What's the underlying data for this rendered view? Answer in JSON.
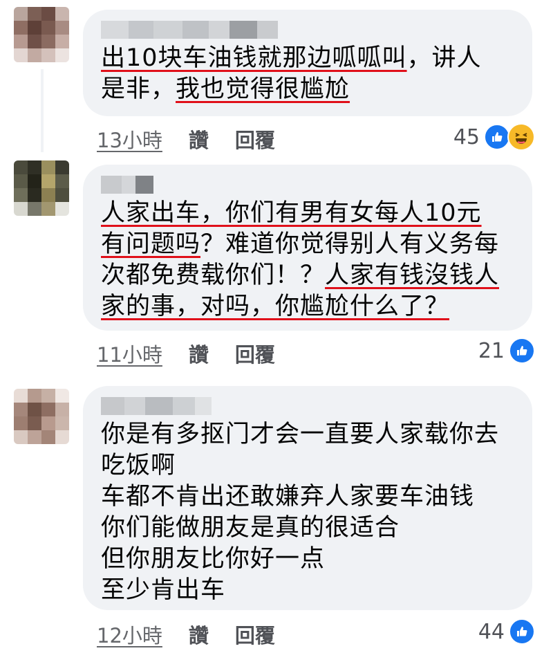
{
  "colors": {
    "bubble": "#f0f2f5",
    "underline": "#e0101a",
    "meta_text": "#65676b",
    "like_blue": "#1877f2",
    "haha_yellow": "#f7b928"
  },
  "comments": [
    {
      "lines": [
        {
          "parts": [
            {
              "text": "出10块车油钱就那边呱呱叫",
              "underline": true
            },
            {
              "text": "，讲人",
              "underline": false
            }
          ]
        },
        {
          "parts": [
            {
              "text": "是非，",
              "underline": false
            },
            {
              "text": "我也觉得很尴尬",
              "underline": true
            }
          ]
        }
      ],
      "time": "13小時",
      "like_label": "讚",
      "reply_label": "回覆",
      "reaction_count": "45",
      "reaction_icons": [
        "like-icon",
        "haha-icon"
      ]
    },
    {
      "lines": [
        {
          "parts": [
            {
              "text": "人家出车",
              "underline": true
            },
            {
              "text": "，你们有男有女每人10元",
              "underline": true
            }
          ]
        },
        {
          "parts": [
            {
              "text": "有问题吗",
              "underline": true
            },
            {
              "text": "？难道你觉得别人有义务每",
              "underline": false
            }
          ]
        },
        {
          "parts": [
            {
              "text": "次都免费载你们！？",
              "underline": false
            },
            {
              "text": "人家有钱沒钱人",
              "underline": true
            }
          ]
        },
        {
          "parts": [
            {
              "text": "家的事，对吗，你尴尬什么了？",
              "underline": true
            }
          ]
        }
      ],
      "time": "11小時",
      "like_label": "讚",
      "reply_label": "回覆",
      "reaction_count": "21",
      "reaction_icons": [
        "like-icon"
      ]
    },
    {
      "lines": [
        {
          "parts": [
            {
              "text": "你是有多抠门才会一直要人家载你去",
              "underline": false
            }
          ]
        },
        {
          "parts": [
            {
              "text": "吃饭啊",
              "underline": false
            }
          ]
        },
        {
          "parts": [
            {
              "text": "车都不肯出还敢嫌弃人家要车油钱",
              "underline": false
            }
          ]
        },
        {
          "parts": [
            {
              "text": "你们能做朋友是真的很适合",
              "underline": false
            }
          ]
        },
        {
          "parts": [
            {
              "text": "但你朋友比你好一点",
              "underline": false
            }
          ]
        },
        {
          "parts": [
            {
              "text": "至少肯出车",
              "underline": false
            }
          ]
        }
      ],
      "time": "12小時",
      "like_label": "讚",
      "reply_label": "回覆",
      "reaction_count": "44",
      "reaction_icons": [
        "like-icon"
      ]
    }
  ]
}
